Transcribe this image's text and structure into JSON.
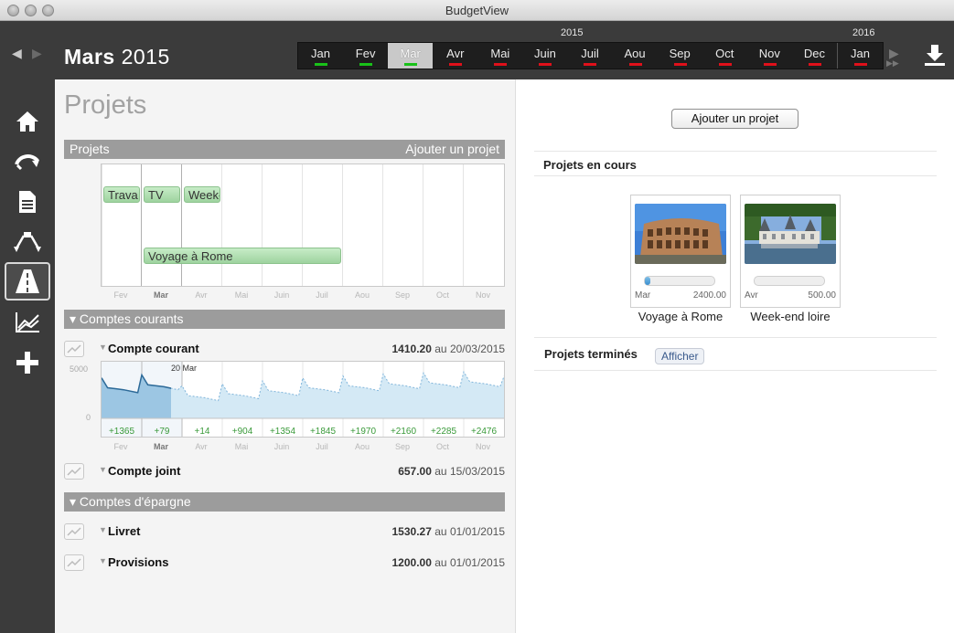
{
  "window": {
    "title": "BudgetView"
  },
  "header": {
    "month": "Mars",
    "year": "2015",
    "year_labels": [
      "2015",
      "2016"
    ],
    "timeline": [
      {
        "label": "Jan",
        "status": "green"
      },
      {
        "label": "Fev",
        "status": "green"
      },
      {
        "label": "Mar",
        "status": "green",
        "selected": true
      },
      {
        "label": "Avr",
        "status": "red"
      },
      {
        "label": "Mai",
        "status": "red"
      },
      {
        "label": "Juin",
        "status": "red"
      },
      {
        "label": "Juil",
        "status": "red"
      },
      {
        "label": "Aou",
        "status": "red"
      },
      {
        "label": "Sep",
        "status": "red"
      },
      {
        "label": "Oct",
        "status": "red"
      },
      {
        "label": "Nov",
        "status": "red"
      },
      {
        "label": "Dec",
        "status": "red"
      },
      {
        "label": "Jan",
        "status": "red"
      }
    ],
    "colors": {
      "green": "#19c219",
      "red": "#e0101a"
    }
  },
  "sidebar": {
    "items": [
      {
        "icon": "home-icon"
      },
      {
        "icon": "refresh-icon"
      },
      {
        "icon": "document-icon"
      },
      {
        "icon": "flows-icon"
      },
      {
        "icon": "projects-road-icon",
        "active": true
      },
      {
        "icon": "analysis-chart-icon"
      },
      {
        "icon": "add-icon"
      }
    ]
  },
  "projects_panel": {
    "title": "Projets",
    "section_label": "Projets",
    "add_label": "Ajouter un projet",
    "gantt_bars": [
      {
        "label": "Trava"
      },
      {
        "label": "TV"
      },
      {
        "label": "Week-"
      },
      {
        "label": "Voyage à Rome"
      }
    ],
    "axis_months": [
      "Fev",
      "Mar",
      "Avr",
      "Mai",
      "Juin",
      "Juil",
      "Aou",
      "Sep",
      "Oct",
      "Nov"
    ]
  },
  "current_accounts": {
    "section_label": "Comptes courants",
    "accounts": [
      {
        "name": "Compte courant",
        "balance": "1410.20",
        "date_prefix": "au",
        "date": "20/03/2015"
      },
      {
        "name": "Compte joint",
        "balance": "657.00",
        "date_prefix": "au",
        "date": "15/03/2015"
      }
    ],
    "chart": {
      "marker": "20 Mar",
      "y_top": "5000",
      "y_zero": "0",
      "monthly_labels": [
        "+1365",
        "+79",
        "+14",
        "+904",
        "+1354",
        "+1845",
        "+1970",
        "+2160",
        "+2285",
        "+2476"
      ]
    }
  },
  "savings_accounts": {
    "section_label": "Comptes d'épargne",
    "accounts": [
      {
        "name": "Livret",
        "balance": "1530.27",
        "date_prefix": "au",
        "date": "01/01/2015"
      },
      {
        "name": "Provisions",
        "balance": "1200.00",
        "date_prefix": "au",
        "date": "01/01/2015"
      }
    ]
  },
  "right_panel": {
    "add_button": "Ajouter un projet",
    "in_progress_title": "Projets en cours",
    "projects": [
      {
        "name": "Voyage à Rome",
        "month": "Mar",
        "amount": "2400.00",
        "progress": 0.05
      },
      {
        "name": "Week-end loire",
        "month": "Avr",
        "amount": "500.00",
        "progress": 0.0
      }
    ],
    "finished_title": "Projets terminés",
    "show_button": "Afficher"
  },
  "chart_data": {
    "type": "area",
    "title": "",
    "xlabel": "",
    "ylabel": "",
    "categories": [
      "Fev",
      "Mar",
      "Avr",
      "Mai",
      "Juin",
      "Juil",
      "Aou",
      "Sep",
      "Oct",
      "Nov"
    ],
    "ylim": [
      0,
      5000
    ],
    "series": [
      {
        "values": [
          2900,
          3200,
          2100,
          2300,
          2600,
          2900,
          3100,
          3300,
          3400,
          3500
        ]
      }
    ],
    "data_labels": [
      "+1365",
      "+79",
      "+14",
      "+904",
      "+1354",
      "+1845",
      "+1970",
      "+2160",
      "+2285",
      "+2476"
    ]
  }
}
